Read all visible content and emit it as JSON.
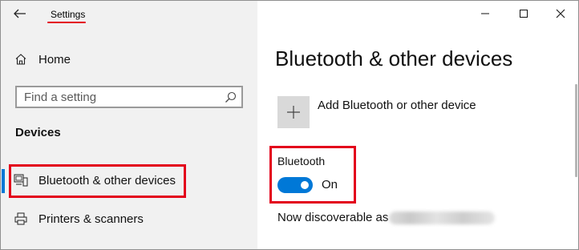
{
  "window": {
    "app_title": "Settings",
    "controls": [
      "minimize",
      "maximize",
      "close"
    ]
  },
  "sidebar": {
    "home_label": "Home",
    "search": {
      "placeholder": "Find a setting"
    },
    "section_label": "Devices",
    "items": [
      {
        "label": "Bluetooth & other devices",
        "icon": "bluetooth-devices-icon",
        "selected": true
      },
      {
        "label": "Printers & scanners",
        "icon": "printer-icon",
        "selected": false
      }
    ]
  },
  "main": {
    "page_title": "Bluetooth & other devices",
    "add_device_label": "Add Bluetooth or other device",
    "bluetooth_label": "Bluetooth",
    "bluetooth_state": "On",
    "bluetooth_enabled": true,
    "discoverable_label": "Now discoverable as"
  },
  "colors": {
    "accent": "#0078d7",
    "highlight": "#e3001b",
    "sidebar_bg": "#f1f1f1",
    "tile_bg": "#d9d9d9"
  }
}
